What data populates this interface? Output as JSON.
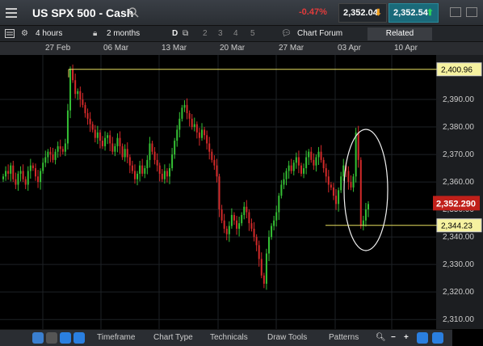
{
  "header": {
    "instrument": "US SPX 500 - Cash",
    "change": "-0.47%",
    "sell_price": "2,352.04",
    "buy_price": "2,352.54"
  },
  "toolbar": {
    "interval": "4 hours",
    "range": "2 months",
    "mode": "D",
    "layouts": [
      "2",
      "3",
      "4",
      "5"
    ],
    "forum": "Chart Forum",
    "related": "Related"
  },
  "dates": [
    "27 Feb",
    "06 Mar",
    "13 Mar",
    "20 Mar",
    "27 Mar",
    "03 Apr",
    "10 Apr"
  ],
  "price_axis": [
    "2,390.00",
    "2,380.00",
    "2,370.00",
    "2,360.00",
    "2,350.00",
    "2,340.00",
    "2,330.00",
    "2,320.00",
    "2,310.00"
  ],
  "markers": {
    "high": "2,400.96",
    "current": "2,352.290",
    "low": "2,344.23"
  },
  "bottom": {
    "timeframe": "Timeframe",
    "chart_type": "Chart Type",
    "technicals": "Technicals",
    "draw_tools": "Draw Tools",
    "patterns": "Patterns"
  },
  "colors": {
    "up": "#35c035",
    "down": "#d42a2a",
    "marker_line": "#e8e060",
    "current_label": "#c0201a"
  },
  "chart_data": {
    "type": "candlestick",
    "ylim": [
      2308,
      2405
    ],
    "y_ticks": [
      2390,
      2380,
      2370,
      2360,
      2350,
      2340,
      2330,
      2320,
      2310
    ],
    "x_ticks": [
      "27 Feb",
      "06 Mar",
      "13 Mar",
      "20 Mar",
      "27 Mar",
      "03 Apr",
      "10 Apr"
    ],
    "horizontal_levels": [
      2400.96,
      2344.23
    ],
    "current_level": 2352.29,
    "closes": [
      2362,
      2364,
      2363,
      2366,
      2361,
      2359,
      2363,
      2364,
      2361,
      2359,
      2364,
      2366,
      2365,
      2362,
      2360,
      2364,
      2367,
      2369,
      2371,
      2370,
      2368,
      2371,
      2373,
      2372,
      2371,
      2374,
      2386,
      2401,
      2397,
      2392,
      2393,
      2390,
      2388,
      2385,
      2383,
      2381,
      2379,
      2376,
      2378,
      2375,
      2373,
      2376,
      2377,
      2374,
      2371,
      2373,
      2376,
      2373,
      2369,
      2372,
      2369,
      2366,
      2364,
      2361,
      2363,
      2366,
      2363,
      2365,
      2368,
      2374,
      2371,
      2368,
      2366,
      2363,
      2361,
      2364,
      2362,
      2365,
      2370,
      2375,
      2379,
      2383,
      2387,
      2388,
      2385,
      2383,
      2380,
      2381,
      2378,
      2376,
      2379,
      2377,
      2374,
      2371,
      2368,
      2366,
      2362,
      2350,
      2346,
      2343,
      2341,
      2344,
      2348,
      2346,
      2343,
      2345,
      2348,
      2351,
      2349,
      2345,
      2343,
      2340,
      2337,
      2332,
      2326,
      2323,
      2334,
      2340,
      2344,
      2346,
      2349,
      2355,
      2359,
      2361,
      2364,
      2366,
      2364,
      2367,
      2369,
      2366,
      2363,
      2365,
      2369,
      2371,
      2368,
      2366,
      2369,
      2371,
      2368,
      2365,
      2362,
      2359,
      2358,
      2355,
      2352,
      2357,
      2362,
      2366,
      2364,
      2360,
      2358,
      2362,
      2378,
      2368,
      2344,
      2346,
      2350,
      2352
    ]
  }
}
